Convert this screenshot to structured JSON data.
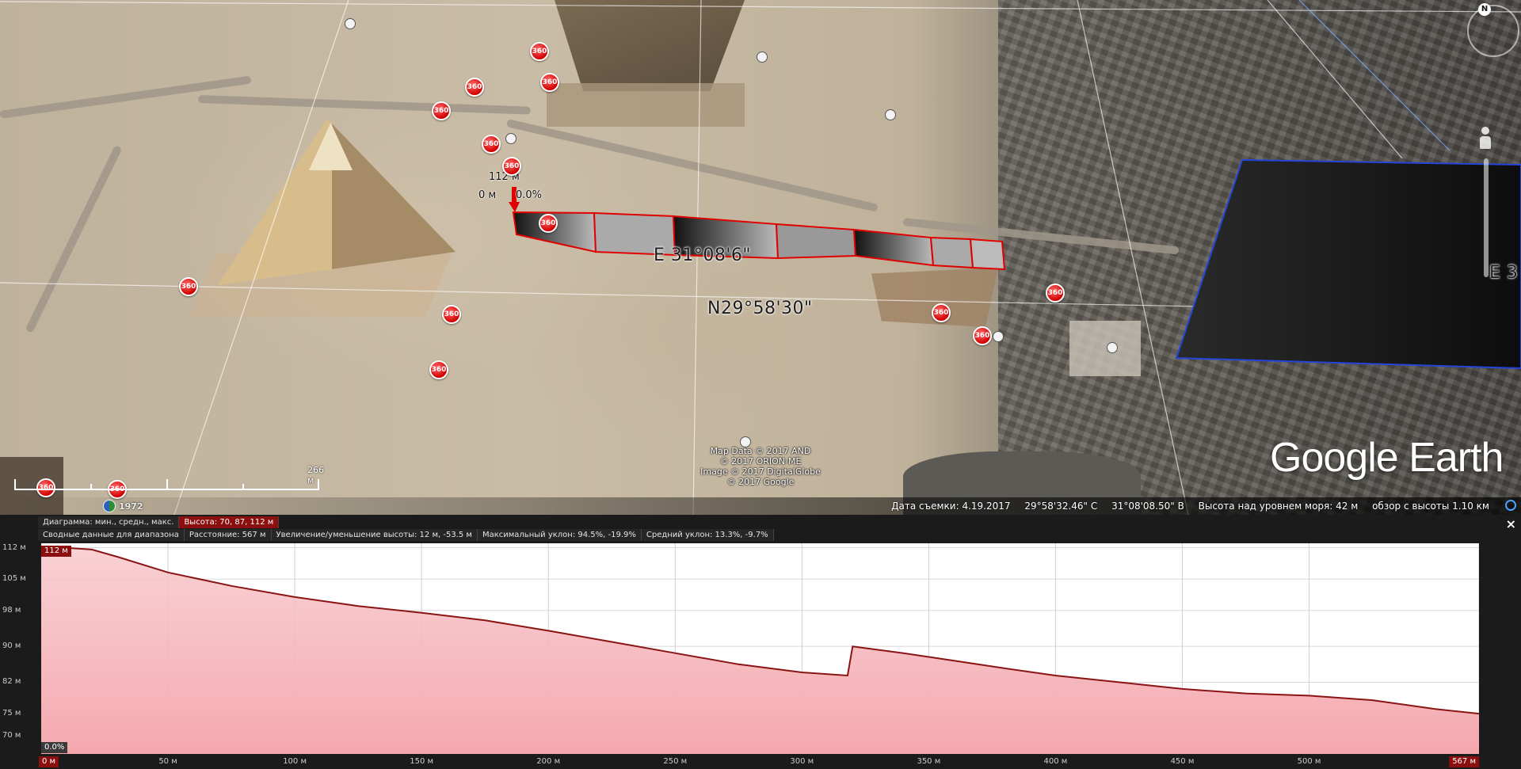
{
  "map": {
    "coord_east": "E 31°08'6\"",
    "coord_north": "N29°58'30\"",
    "coord_east_cut": "E 3",
    "marker_height": "112 м",
    "marker_left": "0 м",
    "marker_right": "0.0%",
    "pin_label": "360",
    "scale_label": "266 м",
    "historical_year": "1972",
    "logo_google": "Google",
    "logo_earth": "Earth",
    "compass_n": "N",
    "copyright_lines": [
      "Map Data © 2017 AND",
      "© 2017 ORION-ME",
      "Image © 2017 DigitalGlobe",
      "© 2017 Google"
    ]
  },
  "status_bar": {
    "date": "Дата съемки: 4.19.2017",
    "lat": "29°58'32.46\" С",
    "lon": "31°08'08.50\" В",
    "elevation": "Высота над уровнем моря:   42 м",
    "eye_alt": "обзор с высоты   1.10 км"
  },
  "profile": {
    "row1": {
      "label": "Диаграмма: мин., средн., макс.",
      "value": "Высота: 70, 87, 112 м"
    },
    "row2": {
      "label": "Сводные данные для диапазона",
      "distance": "Расстояние: 567 м",
      "gain": "Увеличение/уменьшение высоты: 12 м, -53.5 м",
      "max_slope": "Максимальный уклон: 94.5%, -19.9%",
      "avg_slope": "Средний уклон: 13.3%, -9.7%"
    },
    "close_label": "×",
    "tag_top_left": "112 м",
    "tag_bottom_left": "0.0%",
    "tag_x_start": "0 м",
    "tag_x_end": "567 м"
  },
  "chart_data": {
    "type": "area",
    "xlabel": "",
    "ylabel": "",
    "x_unit": "м",
    "y_unit": "м",
    "xlim": [
      0,
      567
    ],
    "ylim": [
      66,
      113
    ],
    "fill_color": "#f4a8ae",
    "line_color": "#8a1414",
    "grid": true,
    "x_ticks": [
      "0 м",
      "50 м",
      "100 м",
      "150 м",
      "200 м",
      "250 м",
      "300 м",
      "350 м",
      "400 м",
      "450 м",
      "500 м",
      "567 м"
    ],
    "x_tick_values": [
      0,
      50,
      100,
      150,
      200,
      250,
      300,
      350,
      400,
      450,
      500,
      567
    ],
    "y_ticks": [
      "112 м",
      "105 м",
      "98 м",
      "90 м",
      "82 м",
      "75 м",
      "70 м"
    ],
    "y_tick_values": [
      112,
      105,
      98,
      90,
      82,
      75,
      70
    ],
    "x": [
      0,
      10,
      20,
      30,
      50,
      75,
      100,
      125,
      150,
      175,
      200,
      225,
      250,
      275,
      300,
      318,
      320,
      340,
      360,
      380,
      400,
      425,
      450,
      475,
      500,
      525,
      550,
      567
    ],
    "y": [
      112,
      112,
      111.6,
      110,
      106.5,
      103.5,
      101,
      99,
      97.5,
      95.8,
      93.5,
      91,
      88.5,
      86,
      84.2,
      83.5,
      90,
      88.5,
      86.8,
      85.1,
      83.5,
      82,
      80.5,
      79.5,
      79,
      78,
      76,
      75
    ]
  }
}
